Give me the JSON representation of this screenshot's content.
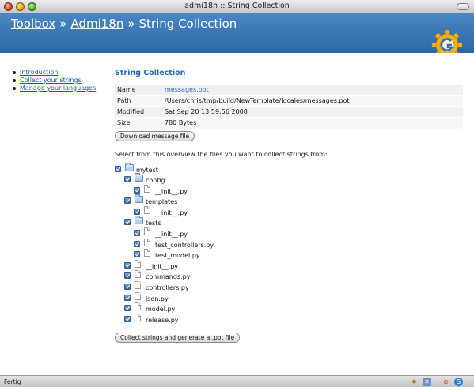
{
  "window": {
    "title": "admi18n :: String Collection"
  },
  "header": {
    "crumbs": [
      {
        "label": "Toolbox"
      },
      {
        "label": "Admi18n"
      }
    ],
    "separator": "»",
    "current": "String Collection",
    "logo_icon": "gear-logo-icon"
  },
  "sidebar": {
    "items": [
      {
        "label": "Introduction"
      },
      {
        "label": "Collect your strings"
      },
      {
        "label": "Manage your languages"
      }
    ]
  },
  "main": {
    "heading": "String Collection",
    "info": {
      "name_label": "Name",
      "name_value": "messages.pot",
      "path_label": "Path",
      "path_value": "/Users/chris/tmp/build/NewTemplate/locales/messages.pot",
      "modified_label": "Modified",
      "modified_value": "Sat Sep 20 13:59:56 2008",
      "size_label": "Size",
      "size_value": "780 Bytes"
    },
    "download_label": "Download message file",
    "prompt": "Select from this overview the files you want to collect strings from:",
    "tree": [
      {
        "name": "mytest",
        "kind": "folder",
        "depth": 0,
        "checked": true
      },
      {
        "name": "config",
        "kind": "folder",
        "depth": 1,
        "checked": true
      },
      {
        "name": "__init__.py",
        "kind": "file",
        "depth": 2,
        "checked": true
      },
      {
        "name": "templates",
        "kind": "folder",
        "depth": 1,
        "checked": true
      },
      {
        "name": "__init__.py",
        "kind": "file",
        "depth": 2,
        "checked": true
      },
      {
        "name": "tests",
        "kind": "folder",
        "depth": 1,
        "checked": true
      },
      {
        "name": "__init__.py",
        "kind": "file",
        "depth": 2,
        "checked": true
      },
      {
        "name": "test_controllers.py",
        "kind": "file",
        "depth": 2,
        "checked": true
      },
      {
        "name": "test_model.py",
        "kind": "file",
        "depth": 2,
        "checked": true
      },
      {
        "name": "__init__.py",
        "kind": "file",
        "depth": 1,
        "checked": true
      },
      {
        "name": "commands.py",
        "kind": "file",
        "depth": 1,
        "checked": true
      },
      {
        "name": "controllers.py",
        "kind": "file",
        "depth": 1,
        "checked": true
      },
      {
        "name": "json.py",
        "kind": "file",
        "depth": 1,
        "checked": true
      },
      {
        "name": "model.py",
        "kind": "file",
        "depth": 1,
        "checked": true
      },
      {
        "name": "release.py",
        "kind": "file",
        "depth": 1,
        "checked": true
      }
    ],
    "collect_label": "Collect strings and generate a .pot file"
  },
  "statusbar": {
    "text": "Fertig",
    "icons": [
      "addon-icon",
      "close-icon",
      "noscript-icon",
      "skype-icon"
    ]
  },
  "colors": {
    "banner": "#3877b8",
    "link": "#1a55c4",
    "heading": "#2a6bb5"
  }
}
